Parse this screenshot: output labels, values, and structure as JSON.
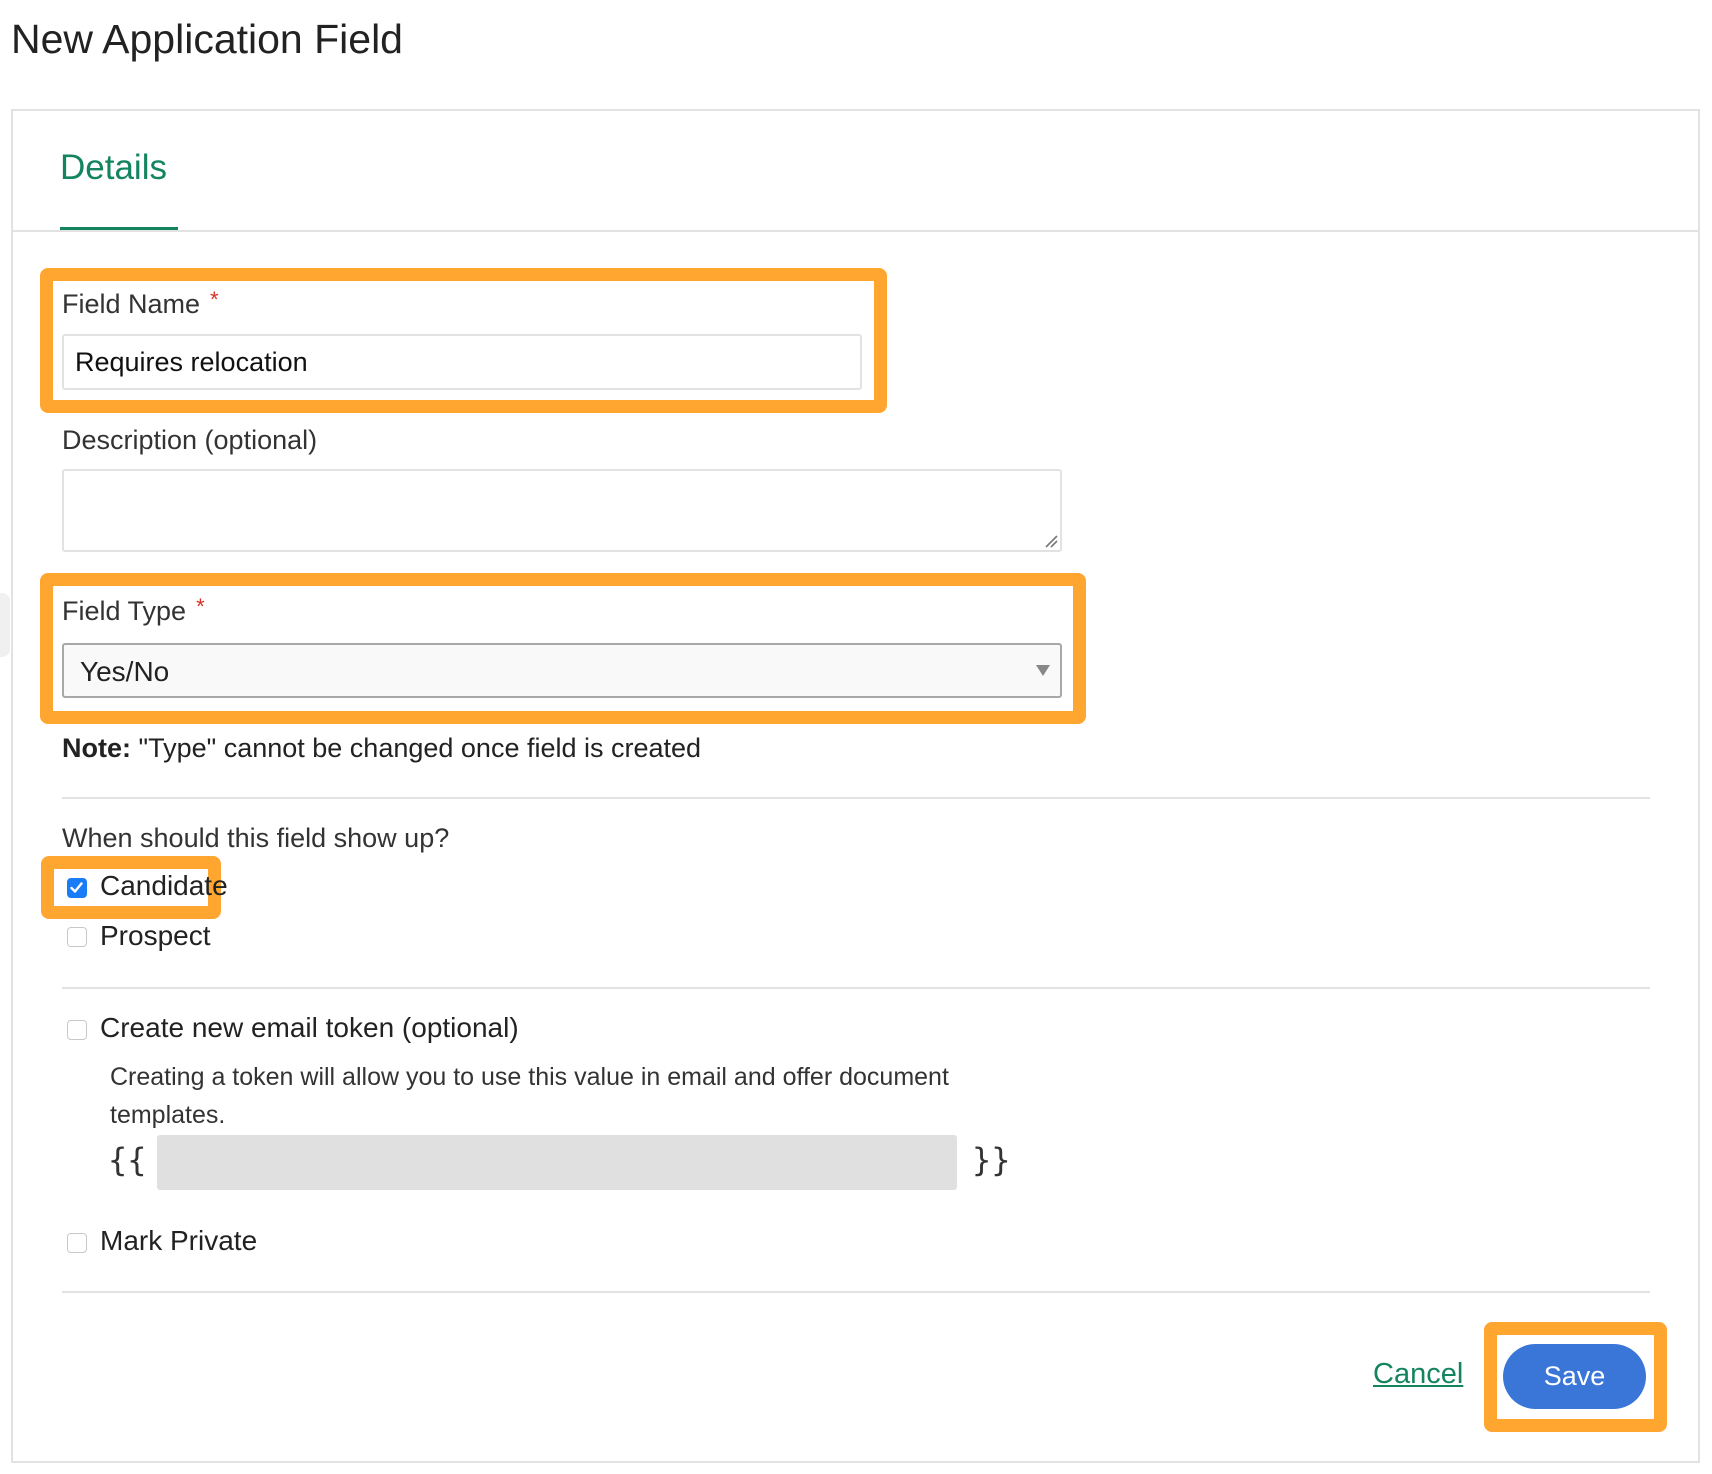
{
  "page": {
    "title": "New Application Field"
  },
  "tabs": [
    {
      "label": "Details",
      "active": true
    }
  ],
  "colors": {
    "accent_green": "#148460",
    "highlight_orange": "#ffa630",
    "primary_blue": "#3a76d8",
    "required_red": "#d93025"
  },
  "form": {
    "field_name": {
      "label": "Field Name",
      "required_marker": "*",
      "value": "Requires relocation"
    },
    "description": {
      "label": "Description (optional)",
      "value": ""
    },
    "field_type": {
      "label": "Field Type",
      "required_marker": "*",
      "selected": "Yes/No"
    },
    "note": {
      "prefix": "Note:",
      "text": " \"Type\" cannot be changed once field is created"
    },
    "visibility": {
      "question": "When should this field show up?",
      "options": [
        {
          "label": "Candidate",
          "checked": true
        },
        {
          "label": "Prospect",
          "checked": false
        }
      ]
    },
    "email_token": {
      "label": "Create new email token (optional)",
      "checked": false,
      "help_line1": "Creating a token will allow you to use this value in email and offer document",
      "help_line2": "templates.",
      "open_brace": "{{",
      "close_brace": "}}",
      "value": ""
    },
    "mark_private": {
      "label": "Mark Private",
      "checked": false
    }
  },
  "actions": {
    "cancel_label": "Cancel",
    "save_label": "Save"
  }
}
